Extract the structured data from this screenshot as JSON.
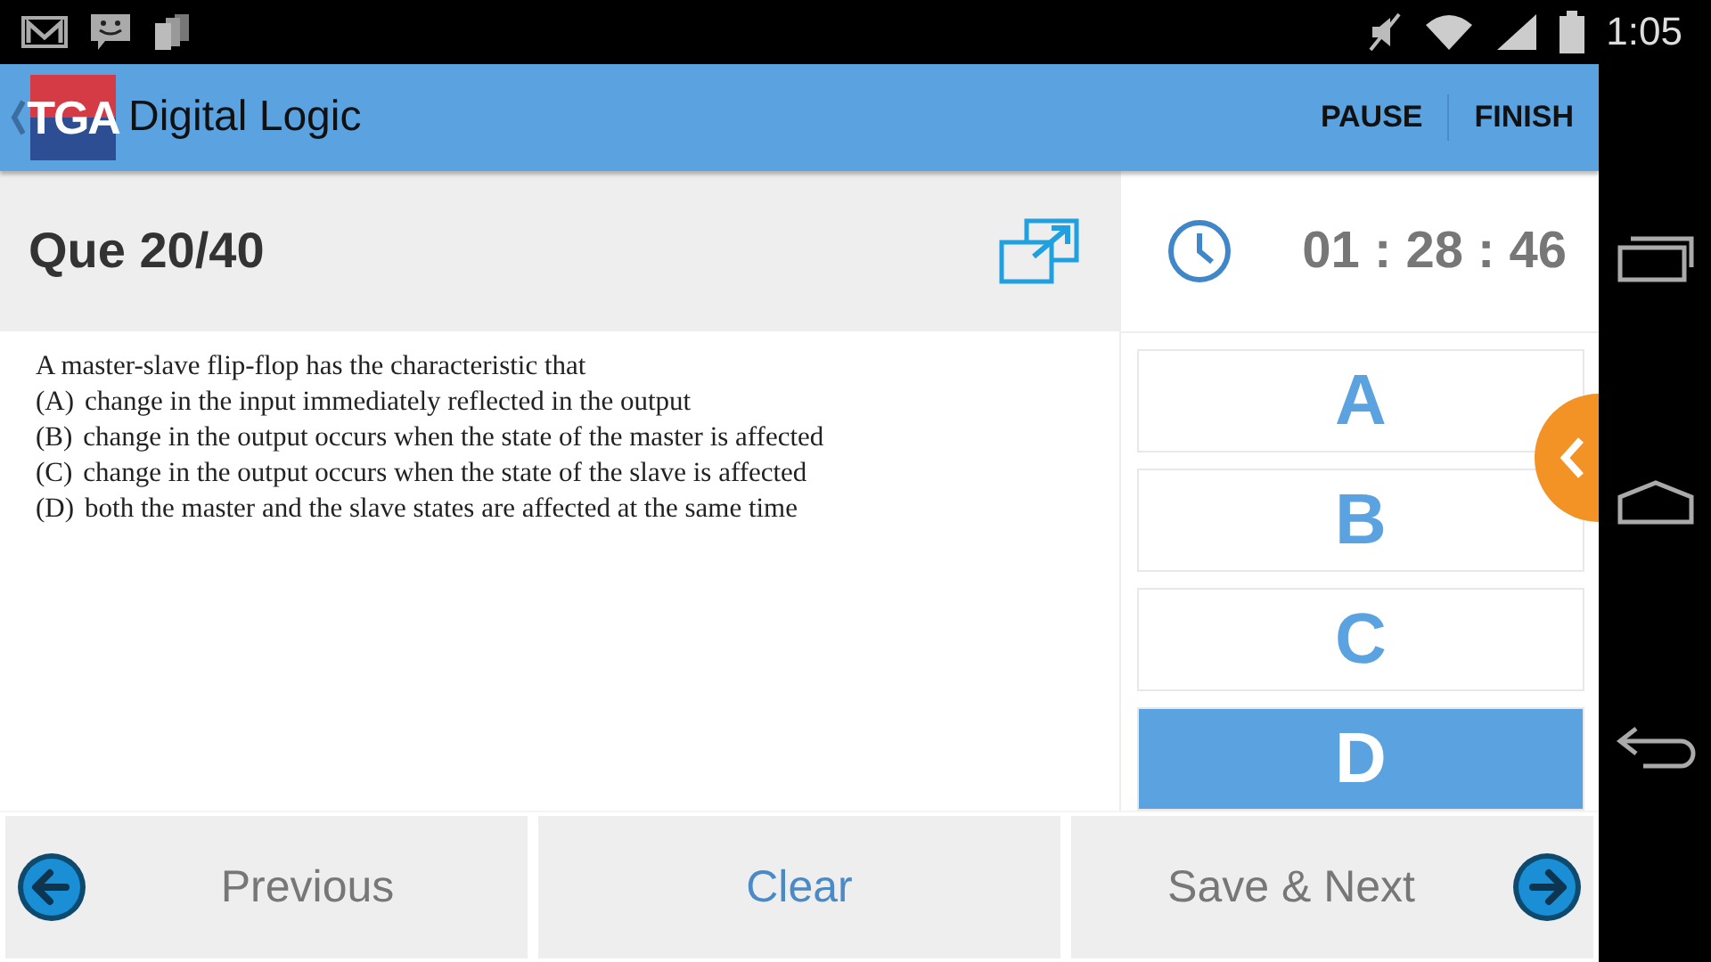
{
  "status_bar": {
    "time": "1:05"
  },
  "app_bar": {
    "logo": "TGA",
    "title": "Digital Logic",
    "actions": [
      "PAUSE",
      "FINISH"
    ]
  },
  "question": {
    "counter": "Que 20/40",
    "stem": "A master-slave flip-flop has the characteristic that",
    "options": [
      {
        "label": "(A)",
        "text": "change in the input immediately reflected in the output"
      },
      {
        "label": "(B)",
        "text": "change in the output occurs when the state of the master is affected"
      },
      {
        "label": "(C)",
        "text": "change in the output occurs when the state of the slave is affected"
      },
      {
        "label": "(D)",
        "text": "both the master and the slave states are affected at the same time"
      }
    ]
  },
  "timer": "01 : 28 : 46",
  "answer_choices": [
    {
      "label": "A",
      "selected": false
    },
    {
      "label": "B",
      "selected": false
    },
    {
      "label": "C",
      "selected": false
    },
    {
      "label": "D",
      "selected": true
    }
  ],
  "bottom_buttons": [
    {
      "kind": "previous",
      "label": "Previous"
    },
    {
      "kind": "clear",
      "label": "Clear"
    },
    {
      "kind": "next",
      "label": "Save & Next"
    }
  ]
}
